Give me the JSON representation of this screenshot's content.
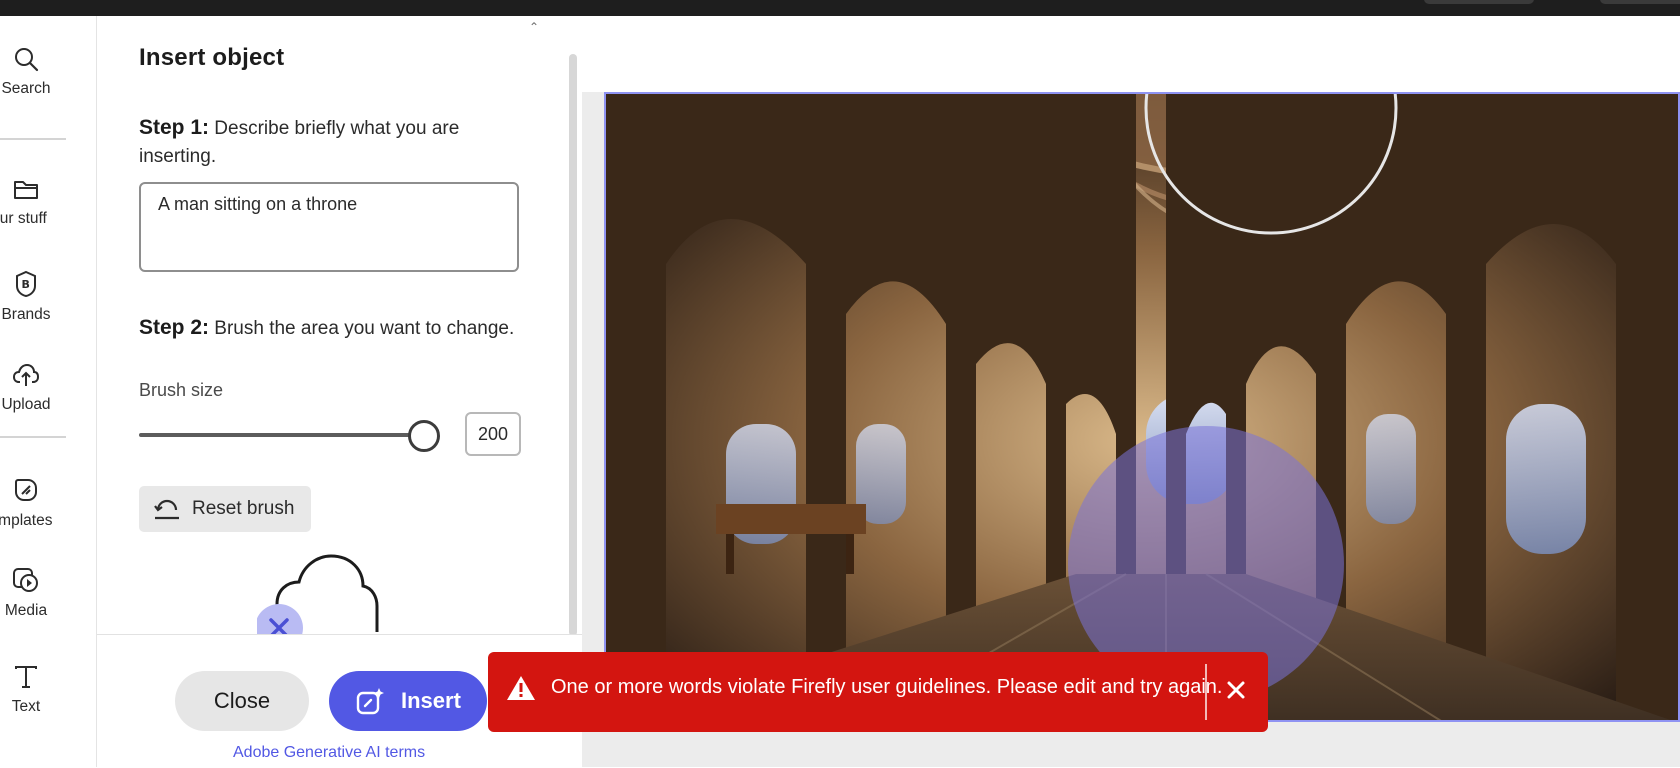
{
  "rail": {
    "items": [
      {
        "label": "Search",
        "icon": "search-icon"
      },
      {
        "label": "our stuff",
        "icon": "folder-icon"
      },
      {
        "label": "Brands",
        "icon": "brand-icon"
      },
      {
        "label": "Upload",
        "icon": "upload-icon"
      },
      {
        "label": "emplates",
        "icon": "templates-icon"
      },
      {
        "label": "Media",
        "icon": "media-icon"
      },
      {
        "label": "Text",
        "icon": "text-icon"
      }
    ]
  },
  "panel": {
    "title": "Insert object",
    "step1_prefix": "Step 1:",
    "step1_text": " Describe briefly what you are inserting.",
    "prompt_value": "A man sitting on a throne",
    "step2_prefix": "Step 2:",
    "step2_text": " Brush the area you want to change.",
    "brush_size_label": "Brush size",
    "brush_size_value": "200",
    "brush_slider_fraction": 1.0,
    "reset_label": "Reset brush",
    "close_label": "Close",
    "insert_label": "Insert",
    "terms_link": "Adobe Generative AI terms"
  },
  "toast": {
    "message": "One or more words violate Firefly user guidelines. Please edit and try again.",
    "color": "#d31510"
  },
  "colors": {
    "accent": "#5258e4",
    "error": "#d31510"
  }
}
